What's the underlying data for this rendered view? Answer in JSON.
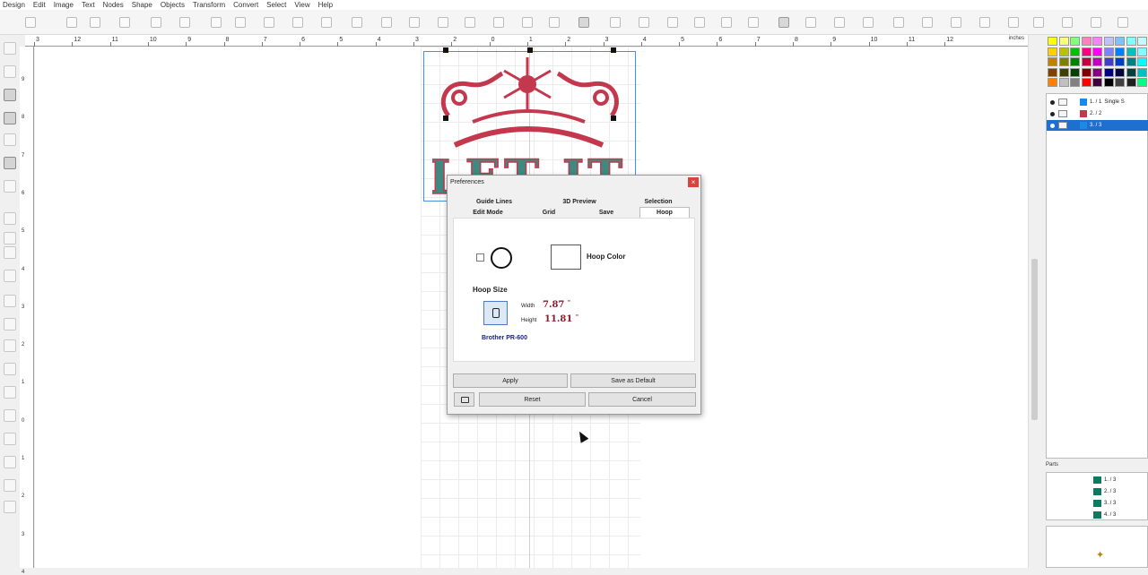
{
  "menu": [
    "Design",
    "Edit",
    "Image",
    "Text",
    "Nodes",
    "Shape",
    "Objects",
    "Transform",
    "Convert",
    "Select",
    "View",
    "Help"
  ],
  "ruler": {
    "top_labels": [
      "3",
      "12",
      "11",
      "10",
      "9",
      "8",
      "7",
      "6",
      "5",
      "4",
      "3",
      "2",
      "0",
      "1",
      "2",
      "3",
      "4",
      "5",
      "6",
      "7",
      "8",
      "9",
      "10",
      "11",
      "12"
    ],
    "units": "inches",
    "left_labels": [
      "9",
      "8",
      "7",
      "6",
      "5",
      "4",
      "3",
      "2",
      "1",
      "0",
      "1",
      "2",
      "3",
      "4"
    ]
  },
  "design": {
    "text": "LET IT",
    "red": "#c4384e",
    "teal": "#3e8a80"
  },
  "dialog": {
    "title": "Preferences",
    "close": "×",
    "tabs_row1": [
      "Guide Lines",
      "3D Preview",
      "Selection"
    ],
    "tabs_row2": [
      "Edit Mode",
      "Grid",
      "Save",
      "Hoop"
    ],
    "selected_tab": "Hoop",
    "hoop_color_label": "Hoop Color",
    "hoop_size_label": "Hoop Size",
    "width_label": "Width",
    "width_value": "7.87",
    "height_label": "Height",
    "height_value": "11.81",
    "unit_symbol": "\"",
    "hoop_name": "Brother PR-600",
    "buttons": {
      "apply": "Apply",
      "save_default": "Save as Default",
      "reset": "Reset",
      "cancel": "Cancel"
    }
  },
  "layers": [
    {
      "label": "1. / 1",
      "name": "Single S",
      "color": "#1e88e5",
      "selected": false
    },
    {
      "label": "2. / 2",
      "name": "",
      "color": "#c4384e",
      "selected": false
    },
    {
      "label": "3. / 3",
      "name": "",
      "color": "#1e88e5",
      "selected": true
    }
  ],
  "parts_label": "Parts",
  "parts": [
    "1. / 3",
    "2. / 3",
    "3. / 3",
    "4. / 3"
  ],
  "palette_colors": [
    "#ffff00",
    "#ffff80",
    "#80ff80",
    "#ff80c0",
    "#ff80ff",
    "#c0c0ff",
    "#80c0ff",
    "#80ffff",
    "#c0ffff",
    "#ffd000",
    "#c0c000",
    "#00c000",
    "#ff0080",
    "#ff00ff",
    "#8080ff",
    "#0080ff",
    "#00c0c0",
    "#80ffff",
    "#c08000",
    "#808000",
    "#008000",
    "#c00040",
    "#c000c0",
    "#4040c0",
    "#0040c0",
    "#008080",
    "#00ffff",
    "#804000",
    "#404000",
    "#004000",
    "#800000",
    "#800080",
    "#000080",
    "#000040",
    "#004040",
    "#00c0c0",
    "#ff8000",
    "#c0c0c0",
    "#808080",
    "#ff0000",
    "#400040",
    "#000000",
    "#404040",
    "#202020",
    "#00ff80"
  ]
}
